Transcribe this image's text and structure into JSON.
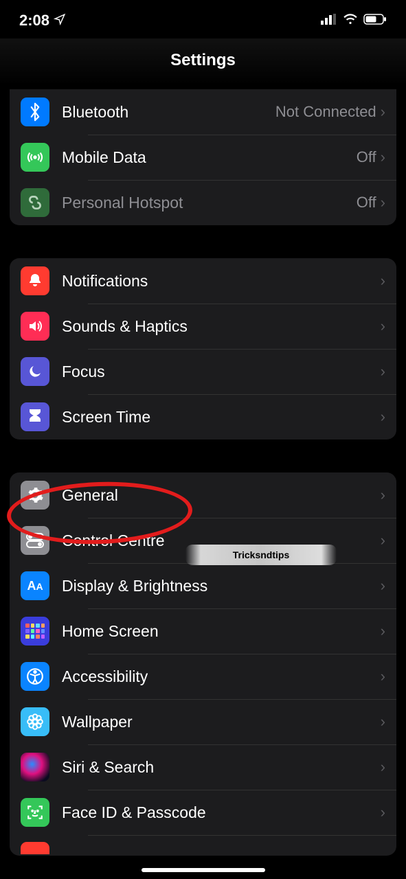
{
  "status": {
    "time": "2:08"
  },
  "header": {
    "title": "Settings"
  },
  "watermark_text": "Tricksndtips",
  "groups": [
    {
      "id": "connectivity",
      "rows": [
        {
          "id": "bluetooth",
          "label": "Bluetooth",
          "value": "Not Connected",
          "icon": "bluetooth-icon",
          "bg": "#007aff",
          "dim": false
        },
        {
          "id": "mobile-data",
          "label": "Mobile Data",
          "value": "Off",
          "icon": "antenna-icon",
          "bg": "#34c759",
          "dim": false
        },
        {
          "id": "personal-hotspot",
          "label": "Personal Hotspot",
          "value": "Off",
          "icon": "link-icon",
          "bg": "#2f6b3a",
          "dim": true
        }
      ]
    },
    {
      "id": "notifications-group",
      "rows": [
        {
          "id": "notifications",
          "label": "Notifications",
          "icon": "bell-icon",
          "bg": "#ff3b30"
        },
        {
          "id": "sounds-haptics",
          "label": "Sounds & Haptics",
          "icon": "speaker-icon",
          "bg": "#ff2d55"
        },
        {
          "id": "focus",
          "label": "Focus",
          "icon": "moon-icon",
          "bg": "#5856d6"
        },
        {
          "id": "screen-time",
          "label": "Screen Time",
          "icon": "hourglass-icon",
          "bg": "#5856d6"
        }
      ]
    },
    {
      "id": "system-group",
      "rows": [
        {
          "id": "general",
          "label": "General",
          "icon": "gear-icon",
          "bg": "#8e8e93"
        },
        {
          "id": "control-centre",
          "label": "Control Centre",
          "icon": "switches-icon",
          "bg": "#8e8e93"
        },
        {
          "id": "display-brightness",
          "label": "Display & Brightness",
          "icon": "text-size-icon",
          "bg": "#0a84ff"
        },
        {
          "id": "home-screen",
          "label": "Home Screen",
          "icon": "app-grid-icon",
          "bg": "#3a3ddc"
        },
        {
          "id": "accessibility",
          "label": "Accessibility",
          "icon": "accessibility-icon",
          "bg": "#0a84ff"
        },
        {
          "id": "wallpaper",
          "label": "Wallpaper",
          "icon": "flower-icon",
          "bg": "#38bdf8"
        },
        {
          "id": "siri-search",
          "label": "Siri & Search",
          "icon": "siri-icon",
          "bg": "grad-siri"
        },
        {
          "id": "face-id-passcode",
          "label": "Face ID & Passcode",
          "icon": "face-id-icon",
          "bg": "#34c759"
        },
        {
          "id": "emergency",
          "label": "",
          "icon": "sos-icon",
          "bg": "#ff3b30"
        }
      ]
    }
  ]
}
